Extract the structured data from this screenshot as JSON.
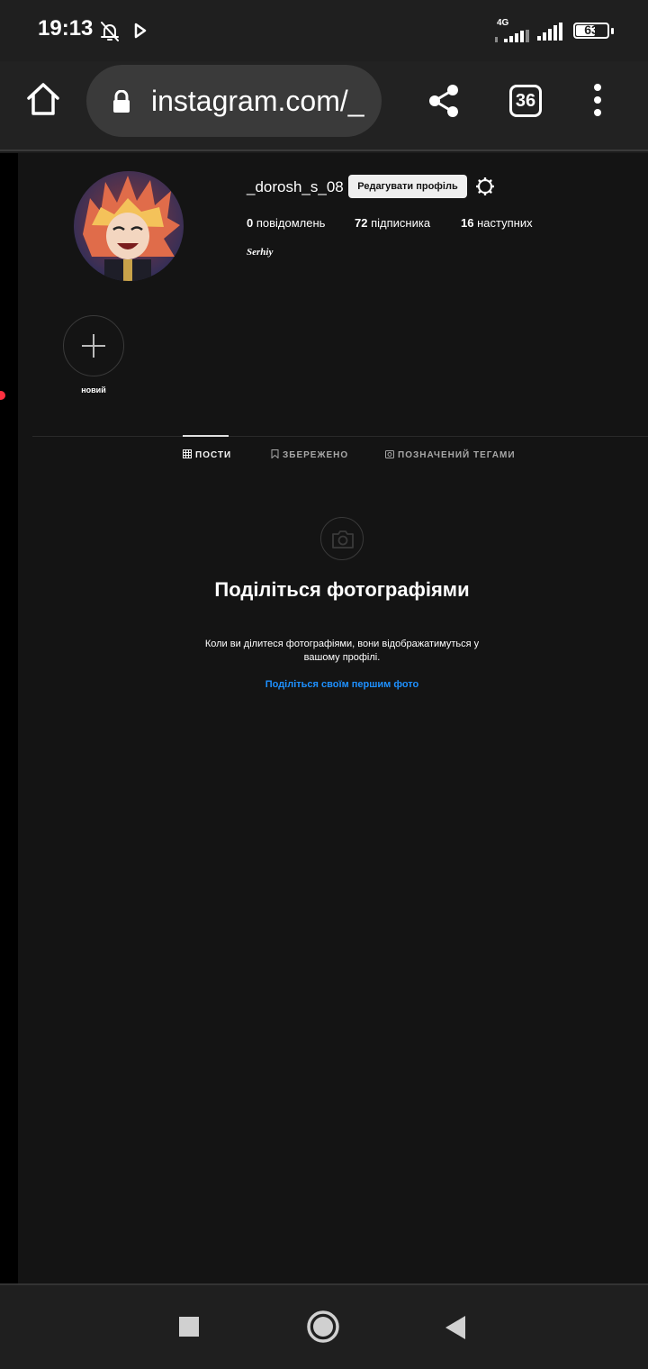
{
  "status_bar": {
    "time": "19:13",
    "network_label": "4G",
    "battery_level": 63,
    "battery_text": "63",
    "icons": [
      "bell-off-icon",
      "play-icon",
      "signal-icon",
      "signal-icon",
      "battery-icon"
    ]
  },
  "browser": {
    "url": "instagram.com/_",
    "tab_count": "36",
    "icons": [
      "home-icon",
      "lock-icon",
      "share-icon",
      "tabs-icon",
      "more-vert-icon"
    ]
  },
  "profile": {
    "username": "_dorosh_s_08",
    "edit_button": "Редагувати профіль",
    "stats": [
      {
        "count": "0",
        "label": "повідомлень"
      },
      {
        "count": "72",
        "label": "підписника"
      },
      {
        "count": "16",
        "label": "наступних"
      }
    ],
    "full_name": "Serhiy"
  },
  "highlights": {
    "new_label": "новий"
  },
  "tabs": [
    {
      "label": "ПОСТИ",
      "icon": "grid-icon",
      "active": true
    },
    {
      "label": "ЗБЕРЕЖЕНО",
      "icon": "bookmark-icon",
      "active": false
    },
    {
      "label": "ПОЗНАЧЕНИЙ ТЕГАМИ",
      "icon": "tag-icon",
      "active": false
    }
  ],
  "empty_state": {
    "title": "Поділіться фотографіями",
    "text": "Коли ви ділитеся фотографіями, вони відображатимуться у вашому профілі.",
    "link": "Поділіться своїм першим фото"
  },
  "colors": {
    "link": "#1e90ff",
    "page_bg": "#141414",
    "notification_dot": "#ff3040"
  },
  "nav_bar": {
    "icons": [
      "recents-square-icon",
      "home-circle-icon",
      "back-triangle-icon"
    ]
  }
}
